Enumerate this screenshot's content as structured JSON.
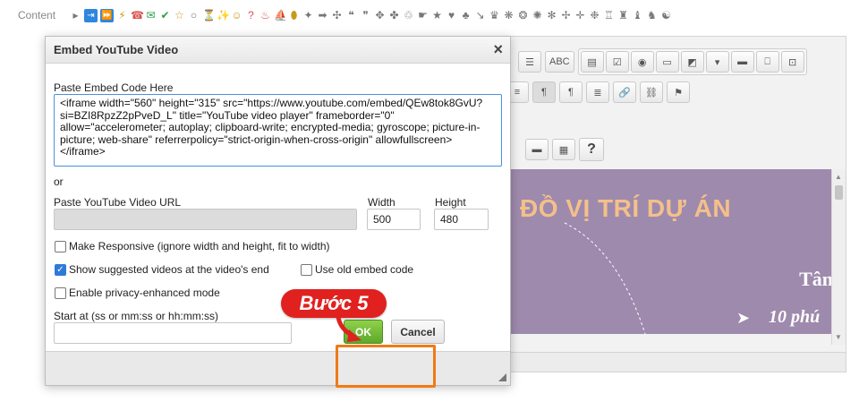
{
  "top_toolbar": {
    "content_label": "Content",
    "symbols": [
      "▸",
      "⇥",
      "⏩",
      "⚡",
      "☎",
      "✉",
      "✔",
      "☆",
      "○",
      "⏳",
      "✨",
      "☺",
      "?",
      "♨",
      "⛵",
      "⬮",
      "✦",
      "➡",
      "✣",
      "❝",
      "❞",
      "✥",
      "✤",
      "♲",
      "☛",
      "★",
      "♥",
      "♣",
      "↘",
      "♛",
      "❋",
      "❂",
      "✺",
      "✻",
      "✢",
      "✛",
      "❉",
      "♖",
      "♜",
      "♝",
      "♞",
      "☯"
    ]
  },
  "editor": {
    "toolbar_row1": [
      "☰",
      "ABC",
      "▤",
      "☑",
      "◉",
      "▭",
      "◩",
      "▾",
      "▬",
      "⎕",
      "⊡"
    ],
    "toolbar_row2": [
      "≡",
      "¶",
      "¶",
      "≣",
      "🔗",
      "⛓",
      "⚑"
    ],
    "help_label": "?",
    "canvas": {
      "title": "ĐỒ VỊ TRÍ DỰ ÁN",
      "side_text": "Tân",
      "arrow": "➤",
      "distance_text": "10 phú",
      "background_color": "#9e8aad"
    }
  },
  "dialog": {
    "title": "Embed YouTube Video",
    "close_label": "×",
    "embed_label": "Paste Embed Code Here",
    "embed_code": "<iframe width=\"560\" height=\"315\" src=\"https://www.youtube.com/embed/QEw8tok8GvU?\nsi=BZI8RpzZ2pPveD_L\" title=\"YouTube video player\" frameborder=\"0\"\nallow=\"accelerometer; autoplay; clipboard-write; encrypted-media; gyroscope; picture-in-\npicture; web-share\" referrerpolicy=\"strict-origin-when-cross-origin\" allowfullscreen>\n</iframe>",
    "or_label": "or",
    "url_label": "Paste YouTube Video URL",
    "url_value": "",
    "width_label": "Width",
    "width_value": "500",
    "height_label": "Height",
    "height_value": "480",
    "options": {
      "make_responsive": {
        "label": "Make Responsive (ignore width and height, fit to width)",
        "checked": false
      },
      "show_suggested": {
        "label": "Show suggested videos at the video's end",
        "checked": true
      },
      "use_old_embed": {
        "label": "Use old embed code",
        "checked": false
      },
      "privacy_enhanced": {
        "label": "Enable privacy-enhanced mode",
        "checked": false
      }
    },
    "start_at_label": "Start at (ss or mm:ss or hh:mm:ss)",
    "start_at_value": "",
    "ok_label": "OK",
    "cancel_label": "Cancel"
  },
  "annotation": {
    "step_label": "Bước 5",
    "highlight_color": "#f07a16",
    "badge_color": "#e0211f"
  }
}
